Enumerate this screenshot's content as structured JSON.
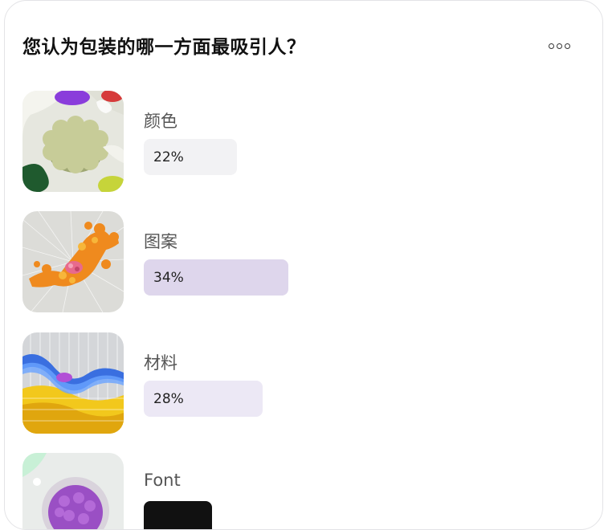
{
  "poll": {
    "question": "您认为包装的哪一方面最吸引人？",
    "more_icon": "more-horizontal-icon",
    "options": [
      {
        "label": "颜色",
        "percent_text": "22%",
        "percent": 22,
        "bar_color": "#f2f2f4",
        "image": "green-flower-shape"
      },
      {
        "label": "图案",
        "percent_text": "34%",
        "percent": 34,
        "bar_color": "#ded6ec",
        "image": "orange-coral-shape"
      },
      {
        "label": "材料",
        "percent_text": "28%",
        "percent": 28,
        "bar_color": "#ece8f5",
        "image": "blue-yellow-wave"
      },
      {
        "label": "Font",
        "percent_text": "",
        "percent": 16,
        "bar_color": "#111111",
        "image": "purple-brain-sphere"
      }
    ]
  }
}
